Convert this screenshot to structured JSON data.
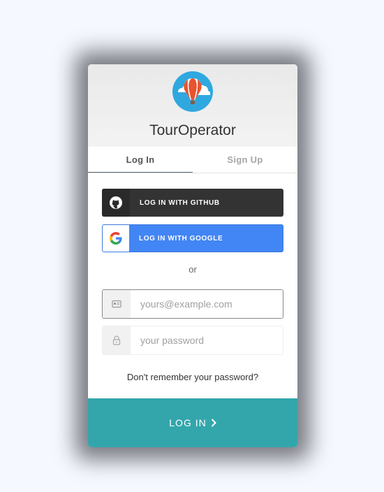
{
  "app": {
    "title": "TourOperator"
  },
  "tabs": [
    {
      "label": "Log In",
      "active": true
    },
    {
      "label": "Sign Up",
      "active": false
    }
  ],
  "social": {
    "github_label": "LOG IN WITH GITHUB",
    "google_label": "LOG IN WITH GOOGLE"
  },
  "separator": "or",
  "form": {
    "email": {
      "value": "",
      "placeholder": "yours@example.com"
    },
    "password": {
      "value": "",
      "placeholder": "your password"
    }
  },
  "forgot_link": "Don't remember your password?",
  "submit_label": "LOG IN",
  "colors": {
    "accent": "#33a6ac",
    "github": "#333333",
    "google": "#4285f4",
    "logo_bg": "#2fa8e0"
  }
}
